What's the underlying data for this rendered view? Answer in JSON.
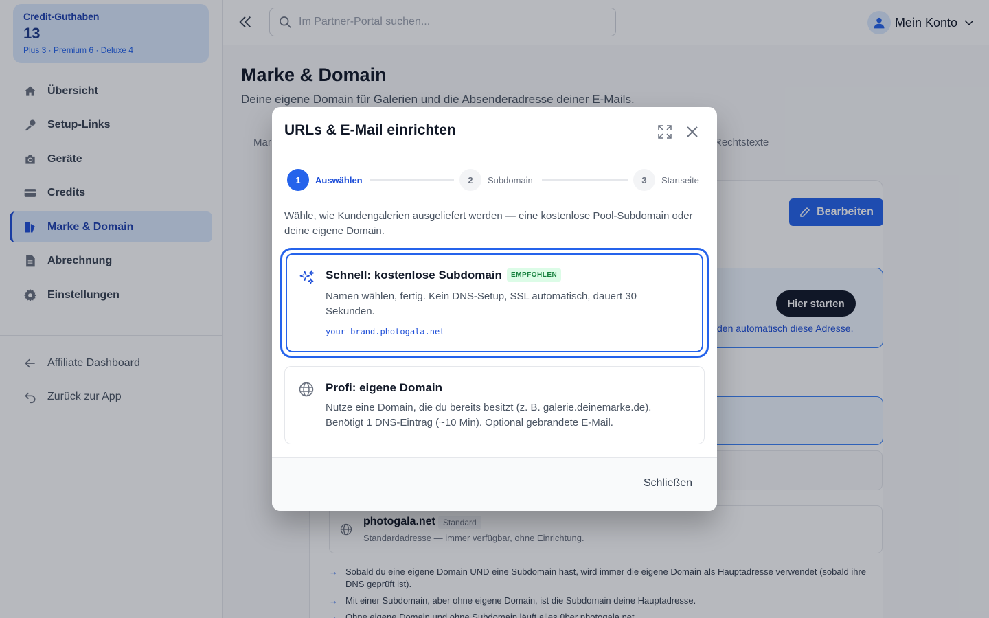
{
  "sidebar": {
    "credit": {
      "label": "Credit-Guthaben",
      "value": "13",
      "detail": "Plus 3 · Premium 6 · Deluxe 4"
    },
    "items": [
      {
        "label": "Übersicht",
        "icon": "home-icon"
      },
      {
        "label": "Setup-Links",
        "icon": "key-icon"
      },
      {
        "label": "Geräte",
        "icon": "camera-icon"
      },
      {
        "label": "Credits",
        "icon": "credit-card-icon"
      },
      {
        "label": "Marke & Domain",
        "icon": "brand-icon",
        "active": true
      },
      {
        "label": "Abrechnung",
        "icon": "document-icon"
      },
      {
        "label": "Einstellungen",
        "icon": "gear-icon"
      }
    ],
    "footer_items": [
      {
        "label": "Affiliate Dashboard",
        "icon": "arrow-left-icon"
      },
      {
        "label": "Zurück zur App",
        "icon": "undo-icon"
      }
    ]
  },
  "topbar": {
    "search_placeholder": "Im Partner-Portal suchen...",
    "account_label": "Mein Konto"
  },
  "page": {
    "title": "Marke & Domain",
    "subtitle": "Deine eigene Domain für Galerien und die Absenderadresse deiner E-Mails.",
    "tab_left_partial": "Mar",
    "tab_right_partial": "Rechtstexte",
    "edit_button": "Bearbeiten",
    "start_button": "Hier starten",
    "info_partial": "den automatisch diese Adresse.",
    "default_domain": {
      "name": "photogala.net",
      "badge": "Standard",
      "desc": "Standardadresse — immer verfügbar, ohne Einrichtung."
    },
    "notes": [
      "Sobald du eine eigene Domain UND eine Subdomain hast, wird immer die eigene Domain als Hauptadresse verwendet (sobald ihre DNS geprüft ist).",
      "Mit einer Subdomain, aber ohne eigene Domain, ist die Subdomain deine Hauptadresse.",
      "Ohne eigene Domain und ohne Subdomain läuft alles über photogala.net"
    ]
  },
  "modal": {
    "title": "URLs & E-Mail einrichten",
    "steps": [
      {
        "num": "1",
        "label": "Auswählen",
        "active": true
      },
      {
        "num": "2",
        "label": "Subdomain",
        "active": false
      },
      {
        "num": "3",
        "label": "Startseite",
        "active": false
      }
    ],
    "intro": "Wähle, wie Kundengalerien ausgeliefert werden — eine kostenlose Pool-Subdomain oder deine eigene Domain.",
    "option_fast": {
      "title": "Schnell: kostenlose Subdomain",
      "badge": "EMPFOHLEN",
      "desc": "Namen wählen, fertig. Kein DNS-Setup, SSL automatisch, dauert 30 Sekunden.",
      "example": "your-brand.photogala.net"
    },
    "option_pro": {
      "title": "Profi: eigene Domain",
      "desc": "Nutze eine Domain, die du bereits besitzt (z. B. galerie.deinemarke.de). Benötigt 1 DNS-Eintrag (~10 Min). Optional gebrandete E-Mail."
    },
    "close_button": "Schließen"
  },
  "colors": {
    "accent": "#2563eb",
    "accent_dark": "#1d4ed8",
    "success": "#15803d",
    "overlay": "rgba(17,24,39,0.3)"
  }
}
